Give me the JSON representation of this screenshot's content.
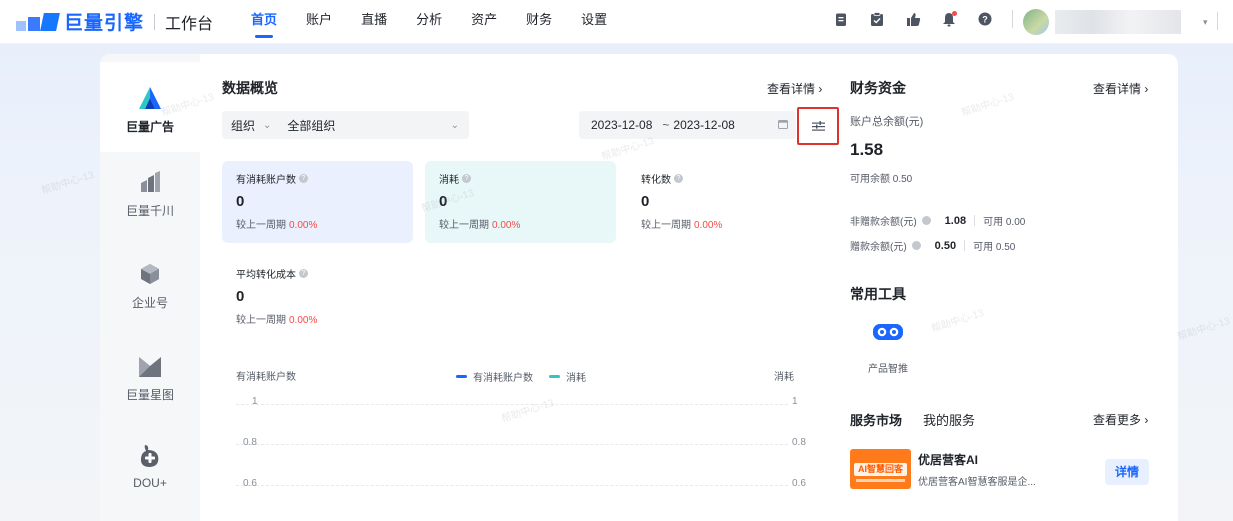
{
  "app": {
    "brand": "巨量引擎",
    "workspace": "工作台"
  },
  "nav": [
    "首页",
    "账户",
    "直播",
    "分析",
    "资产",
    "财务",
    "设置"
  ],
  "top_icons": [
    "clipboard-icon",
    "checklist-icon",
    "thumbs-up-icon",
    "bell-icon",
    "help-icon"
  ],
  "sidebar": [
    "巨量广告",
    "巨量千川",
    "企业号",
    "巨量星图",
    "DOU+"
  ],
  "overview": {
    "title": "数据概览",
    "detail_link": "查看详情",
    "org_label": "组织",
    "org_value": "全部组织",
    "date_start": "2023-12-08",
    "date_sep": "~",
    "date_end": "2023-12-08",
    "compare_label": "较上一周期",
    "metrics": [
      {
        "label": "有消耗账户数",
        "value": "0",
        "change": "0.00%"
      },
      {
        "label": "消耗",
        "value": "0",
        "change": "0.00%"
      },
      {
        "label": "转化数",
        "value": "0",
        "change": "0.00%"
      },
      {
        "label": "平均转化成本",
        "value": "0",
        "change": "0.00%"
      }
    ],
    "chart": {
      "left_axis_label": "有消耗账户数",
      "right_axis_label": "消耗",
      "legend": [
        {
          "name": "有消耗账户数",
          "color": "#1a66ff"
        },
        {
          "name": "消耗",
          "color": "#2ec7c9"
        }
      ],
      "y_ticks": [
        "1",
        "0.8",
        "0.6"
      ]
    }
  },
  "finance": {
    "title": "财务资金",
    "detail_link": "查看详情",
    "total_label": "账户总余额(元)",
    "total_value": "1.58",
    "available_label": "可用余额 0.50",
    "non_gift_label": "非赠款余额(元)",
    "non_gift_value": "1.08",
    "non_gift_available": "可用 0.00",
    "gift_label": "赠款余额(元)",
    "gift_value": "0.50",
    "gift_available": "可用 0.50"
  },
  "tools": {
    "title": "常用工具",
    "items": [
      {
        "label": "产品智推",
        "icon": "glasses-icon"
      }
    ]
  },
  "services": {
    "tab_market": "服务市场",
    "tab_mine": "我的服务",
    "more_link": "查看更多",
    "items": [
      {
        "name": "优居营客AI",
        "desc": "优居营客AI智慧客服是企...",
        "thumb_text": "AI智慧回客",
        "action": "详情"
      }
    ]
  },
  "watermark": "帮助中心-13"
}
